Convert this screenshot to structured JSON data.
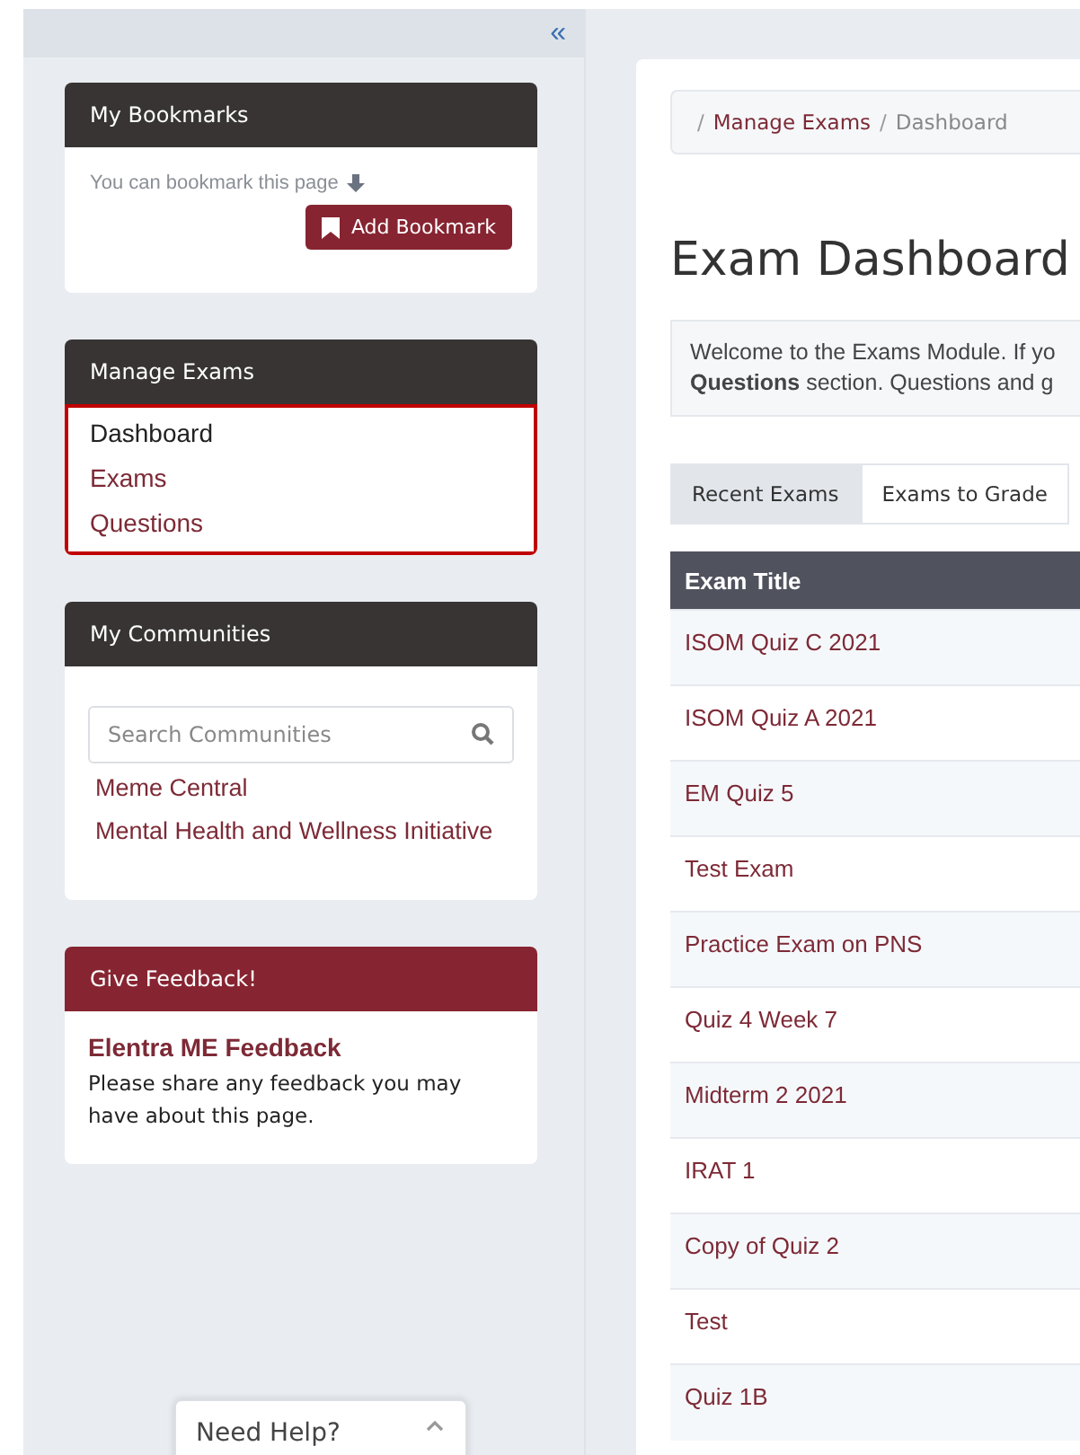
{
  "sidebar": {
    "collapse_glyph": "«",
    "panels": [
      {
        "kind": "bookmarks",
        "title": "My Bookmarks",
        "hint": "You can bookmark this page",
        "button": "Add Bookmark"
      },
      {
        "kind": "menu",
        "title": "Manage Exams",
        "highlighted": true,
        "items": [
          {
            "label": "Dashboard",
            "selected": true
          },
          {
            "label": "Exams",
            "selected": false
          },
          {
            "label": "Questions",
            "selected": false
          }
        ]
      },
      {
        "kind": "communities",
        "title": "My Communities",
        "search": {
          "placeholder": "Search Communities"
        },
        "links": [
          "Meme Central",
          "Mental Health and Wellness Initiative"
        ]
      },
      {
        "kind": "feedback",
        "title": "Give Feedback!",
        "link": "Elentra ME Feedback",
        "text": "Please share any feedback you may have about this page."
      }
    ]
  },
  "breadcrumb": {
    "separator": "/",
    "items": [
      {
        "label": "Manage Exams",
        "link": true
      },
      {
        "label": "Dashboard",
        "link": false
      }
    ]
  },
  "page_title": "Exam Dashboard",
  "notice": [
    "Welcome to the Exams Module. If yo",
    "**Questions** section. Questions and g"
  ],
  "tabs": [
    {
      "label": "Recent Exams",
      "selected": true
    },
    {
      "label": "Exams to Grade",
      "selected": false
    }
  ],
  "table": {
    "columns": [
      "Exam Title"
    ],
    "rows": [
      [
        "ISOM Quiz C 2021"
      ],
      [
        "ISOM Quiz A 2021"
      ],
      [
        "EM Quiz 5"
      ],
      [
        "Test Exam"
      ],
      [
        "Practice Exam on PNS"
      ],
      [
        "Quiz 4 Week 7"
      ],
      [
        "Midterm 2 2021"
      ],
      [
        "IRAT 1"
      ],
      [
        "Copy of Quiz 2"
      ],
      [
        "Test"
      ],
      [
        "Quiz 1B"
      ]
    ]
  },
  "help_widget": {
    "label": "Need Help?"
  }
}
